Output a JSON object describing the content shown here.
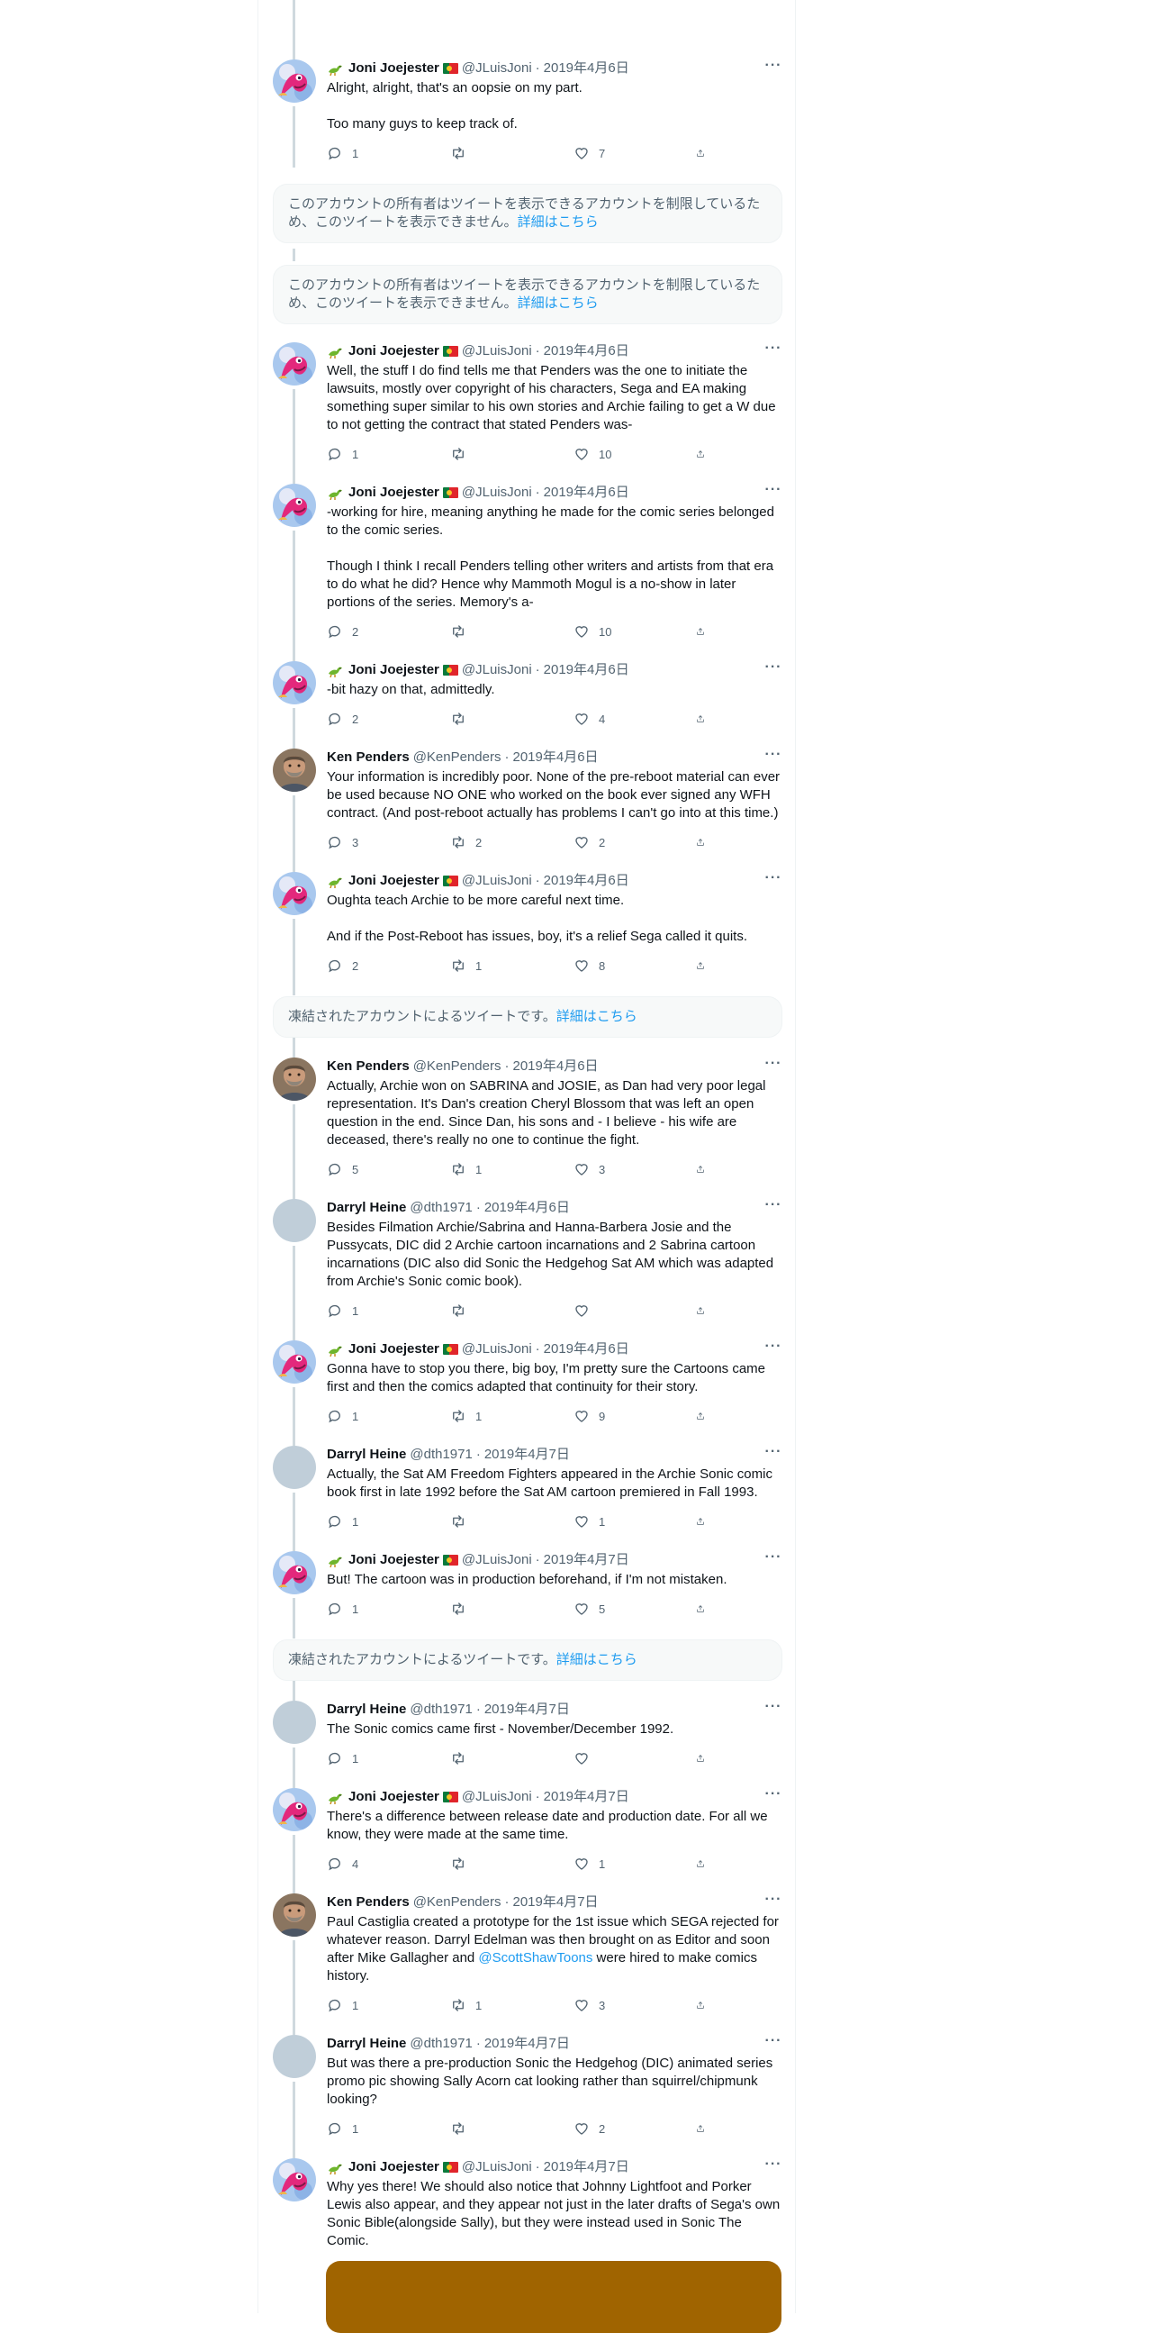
{
  "tweets": [
    {
      "name": "Joni Joejester",
      "handle": "@JLuisJoni",
      "date": "2019年4月6日",
      "lizard": true,
      "flag": true,
      "avatar": "pink-character",
      "paragraphs": [
        "Alright, alright, that's an oopsie on my part.",
        "Too many guys to keep track of."
      ],
      "replies": "1",
      "retweets": "",
      "likes": "7"
    },
    {
      "name": "Joni Joejester",
      "handle": "@JLuisJoni",
      "date": "2019年4月6日",
      "lizard": true,
      "flag": true,
      "avatar": "pink-character",
      "paragraphs": [
        "Well, the stuff I do find tells me that Penders was the one to initiate the lawsuits, mostly over copyright of his characters, Sega and EA making something super similar to his own stories and Archie failing to get a W due to not getting the contract that stated Penders was-"
      ],
      "replies": "1",
      "retweets": "",
      "likes": "10"
    },
    {
      "name": "Joni Joejester",
      "handle": "@JLuisJoni",
      "date": "2019年4月6日",
      "lizard": true,
      "flag": true,
      "avatar": "pink-character",
      "paragraphs": [
        "-working for hire, meaning anything he made for the comic series belonged to the comic series.",
        "Though I think I recall Penders telling other writers and artists from that era to do what he did? Hence why Mammoth Mogul is a no-show in later portions of the series. Memory's a-"
      ],
      "replies": "2",
      "retweets": "",
      "likes": "10"
    },
    {
      "name": "Joni Joejester",
      "handle": "@JLuisJoni",
      "date": "2019年4月6日",
      "lizard": true,
      "flag": true,
      "avatar": "pink-character",
      "paragraphs": [
        "-bit hazy on that, admittedly."
      ],
      "replies": "2",
      "retweets": "",
      "likes": "4"
    },
    {
      "name": "Ken Penders",
      "handle": "@KenPenders",
      "date": "2019年4月6日",
      "lizard": false,
      "flag": false,
      "avatar": "photo",
      "paragraphs": [
        "Your information is incredibly poor. None of the pre-reboot material can ever be used because NO ONE who worked on the book ever signed any WFH contract. (And post-reboot actually has problems I can't go into at this time.)"
      ],
      "replies": "3",
      "retweets": "2",
      "likes": "2"
    },
    {
      "name": "Joni Joejester",
      "handle": "@JLuisJoni",
      "date": "2019年4月6日",
      "lizard": true,
      "flag": true,
      "avatar": "pink-character",
      "paragraphs": [
        "Oughta teach Archie to be more careful next time.",
        "And if the Post-Reboot has issues, boy, it's a relief Sega called it quits."
      ],
      "replies": "2",
      "retweets": "1",
      "likes": "8"
    },
    {
      "name": "Ken Penders",
      "handle": "@KenPenders",
      "date": "2019年4月6日",
      "lizard": false,
      "flag": false,
      "avatar": "photo",
      "paragraphs": [
        "Actually, Archie won on SABRINA and JOSIE, as Dan had very poor legal representation. It's Dan's creation Cheryl Blossom that was left an open question in the end. Since Dan, his sons and - I believe - his wife are deceased, there's really no one to continue the fight."
      ],
      "replies": "5",
      "retweets": "1",
      "likes": "3"
    },
    {
      "name": "Darryl Heine",
      "handle": "@dth1971",
      "date": "2019年4月6日",
      "lizard": false,
      "flag": false,
      "avatar": "default",
      "paragraphs": [
        "Besides Filmation Archie/Sabrina and Hanna-Barbera Josie and the Pussycats, DIC did 2 Archie cartoon incarnations and 2 Sabrina cartoon incarnations (DIC also did Sonic the Hedgehog Sat AM which was adapted from Archie's Sonic comic book)."
      ],
      "replies": "1",
      "retweets": "",
      "likes": ""
    },
    {
      "name": "Joni Joejester",
      "handle": "@JLuisJoni",
      "date": "2019年4月6日",
      "lizard": true,
      "flag": true,
      "avatar": "pink-character",
      "paragraphs": [
        "Gonna have to stop you there, big boy, I'm pretty sure the Cartoons came first and then the comics adapted that continuity for their story."
      ],
      "replies": "1",
      "retweets": "1",
      "likes": "9"
    },
    {
      "name": "Darryl Heine",
      "handle": "@dth1971",
      "date": "2019年4月7日",
      "lizard": false,
      "flag": false,
      "avatar": "default",
      "paragraphs": [
        "Actually, the Sat AM Freedom Fighters appeared in the Archie Sonic comic book first in late 1992 before the Sat AM cartoon premiered in Fall 1993."
      ],
      "replies": "1",
      "retweets": "",
      "likes": "1"
    },
    {
      "name": "Joni Joejester",
      "handle": "@JLuisJoni",
      "date": "2019年4月7日",
      "lizard": true,
      "flag": true,
      "avatar": "pink-character",
      "paragraphs": [
        "But! The cartoon was in production beforehand, if I'm not mistaken."
      ],
      "replies": "1",
      "retweets": "",
      "likes": "5"
    },
    {
      "name": "Darryl Heine",
      "handle": "@dth1971",
      "date": "2019年4月7日",
      "lizard": false,
      "flag": false,
      "avatar": "default",
      "paragraphs": [
        "The Sonic comics came first - November/December 1992."
      ],
      "replies": "1",
      "retweets": "",
      "likes": ""
    },
    {
      "name": "Joni Joejester",
      "handle": "@JLuisJoni",
      "date": "2019年4月7日",
      "lizard": true,
      "flag": true,
      "avatar": "pink-character",
      "paragraphs": [
        "There's a difference between release date and production date. For all we know, they were made at the same time."
      ],
      "replies": "4",
      "retweets": "",
      "likes": "1"
    },
    {
      "name": "Ken Penders",
      "handle": "@KenPenders",
      "date": "2019年4月7日",
      "lizard": false,
      "flag": false,
      "avatar": "photo",
      "paragraphs": [
        "Paul Castiglia created a prototype for the 1st issue which SEGA rejected for whatever reason. Darryl Edelman was then brought on as Editor and soon after Mike Gallagher and {@ScottShawToons} were hired to make comics history."
      ],
      "replies": "1",
      "retweets": "1",
      "likes": "3"
    },
    {
      "name": "Darryl Heine",
      "handle": "@dth1971",
      "date": "2019年4月7日",
      "lizard": false,
      "flag": false,
      "avatar": "default",
      "paragraphs": [
        "But was there a pre-production Sonic the Hedgehog (DIC) animated series promo pic showing Sally Acorn cat looking rather than squirrel/chipmunk looking?"
      ],
      "replies": "1",
      "retweets": "",
      "likes": "2"
    },
    {
      "name": "Joni Joejester",
      "handle": "@JLuisJoni",
      "date": "2019年4月7日",
      "lizard": true,
      "flag": true,
      "avatar": "pink-character",
      "paragraphs": [
        "Why yes there! We should also notice that Johnny Lightfoot and Porker Lewis also appear, and they appear not just in the later drafts of Sega's own Sonic Bible(alongside Sally), but they were instead used in Sonic The Comic."
      ],
      "replies": "",
      "retweets": "",
      "likes": ""
    }
  ],
  "notices": [
    {
      "text": "このアカウントの所有者はツイートを表示できるアカウントを制限しているため、このツイートを表示できません。",
      "link": "詳細はこちら"
    },
    {
      "text": "このアカウントの所有者はツイートを表示できるアカウントを制限しているため、このツイートを表示できません。",
      "link": "詳細はこちら"
    },
    {
      "text": "凍結されたアカウントによるツイートです。",
      "link": "詳細はこちら"
    },
    {
      "text": "凍結されたアカウントによるツイートです。",
      "link": "詳細はこちら"
    }
  ],
  "colors": {
    "accent": "#1d9bf0",
    "muted": "#536471",
    "media": "#a06400"
  }
}
